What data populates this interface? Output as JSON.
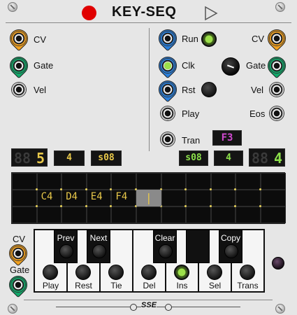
{
  "module": {
    "title": "KEY-SEQ",
    "brand": "SSE"
  },
  "colors": {
    "panel": "#e6e6e6",
    "accent_yellow": "#e8c84a",
    "accent_green": "#8ce04a",
    "accent_magenta": "#d04ad0",
    "record_red": "#e00000"
  },
  "left_io": {
    "cv_label": "CV",
    "gate_label": "Gate",
    "vel_label": "Vel"
  },
  "center_controls": {
    "run_label": "Run",
    "clk_label": "Clk",
    "rst_label": "Rst",
    "play_label": "Play",
    "tran_label": "Tran",
    "tran_display": "F3"
  },
  "right_io": {
    "cv_label": "CV",
    "gate_label": "Gate",
    "vel_label": "Vel",
    "eos_label": "Eos"
  },
  "displays_left": {
    "step_count_ghost": "88",
    "step_count": "5",
    "value_a": "4",
    "value_b": "s08"
  },
  "displays_right": {
    "value_b": "s08",
    "value_a": "4",
    "step_count_ghost": "88",
    "step_count": "4"
  },
  "sequence": {
    "notes": [
      "C4",
      "D4",
      "E4",
      "F4"
    ],
    "cursor": "|"
  },
  "keyboard_io": {
    "cv_label": "CV",
    "gate_label": "Gate"
  },
  "edit_buttons": {
    "prev_label": "Prev",
    "next_label": "Next",
    "clear_label": "Clear",
    "copy_label": "Copy",
    "play_label": "Play",
    "rest_label": "Rest",
    "tie_label": "Tie",
    "del_label": "Del",
    "ins_label": "Ins",
    "sel_label": "Sel",
    "trans_label": "Trans"
  }
}
